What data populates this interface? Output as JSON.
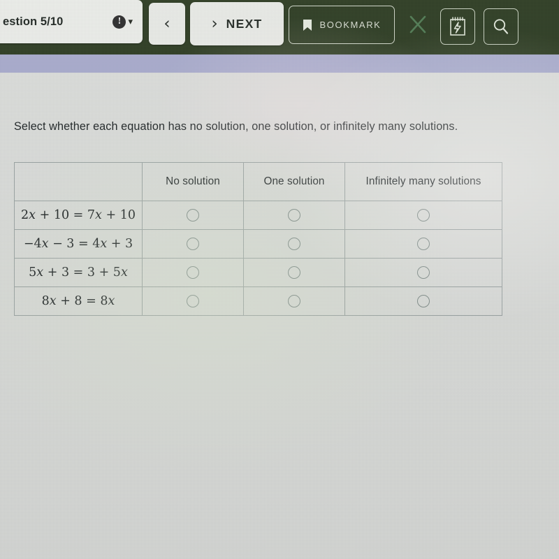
{
  "toolbar": {
    "question_counter": "estion 5/10",
    "alert_icon": "exclamation-circle-icon",
    "dropdown_icon": "chevron-down-icon",
    "prev_label": "‹",
    "next_arrow": "›",
    "next_label": "NEXT",
    "bookmark_label": "BOOKMARK",
    "bookmark_icon": "bookmark-icon",
    "close_icon": "close-x-icon",
    "notes_icon": "notepad-icon",
    "search_icon": "magnifier-icon",
    "bg_color": "#2b3a20",
    "accent_band_color": "#a8abcd"
  },
  "content": {
    "prompt": "Select whether each equation has no solution, one solution, or infinitely many solutions.",
    "background_color": "#dcdedb"
  },
  "table": {
    "row_header_blank": "",
    "columns": [
      "No solution",
      "One solution",
      "Infinitely many solutions"
    ],
    "rows": [
      {
        "equation": "2x + 10 = 7x + 10",
        "selected": null
      },
      {
        "equation": "−4x − 3 = 4x + 3",
        "selected": null
      },
      {
        "equation": "5x + 3 = 3 + 5x",
        "selected": null
      },
      {
        "equation": "8x + 8 = 8x",
        "selected": null
      }
    ]
  }
}
